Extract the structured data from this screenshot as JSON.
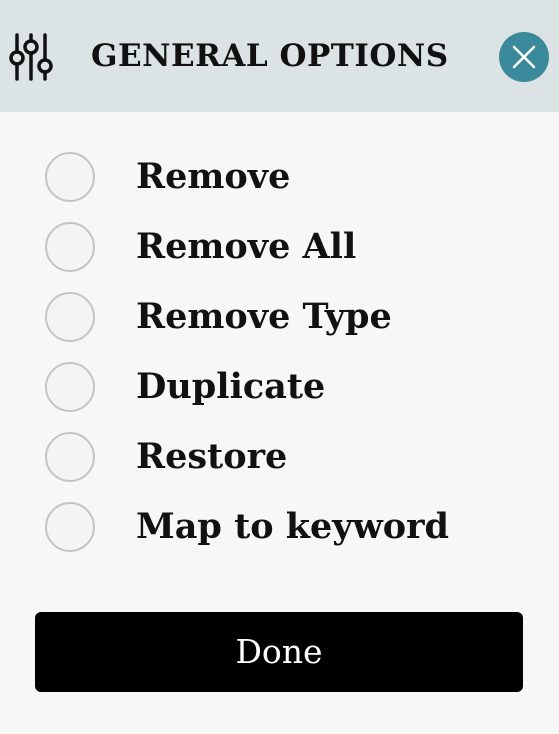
{
  "header": {
    "title": "GENERAL OPTIONS",
    "icon": "sliders-icon",
    "close_icon": "close-icon",
    "background": "#dbe3e4",
    "close_color": "#3a8a9c"
  },
  "options": [
    {
      "label": "Remove",
      "selected": false
    },
    {
      "label": "Remove All",
      "selected": false
    },
    {
      "label": "Remove Type",
      "selected": false
    },
    {
      "label": "Duplicate",
      "selected": false
    },
    {
      "label": "Restore",
      "selected": false
    },
    {
      "label": "Map to keyword",
      "selected": false
    }
  ],
  "done_label": "Done"
}
